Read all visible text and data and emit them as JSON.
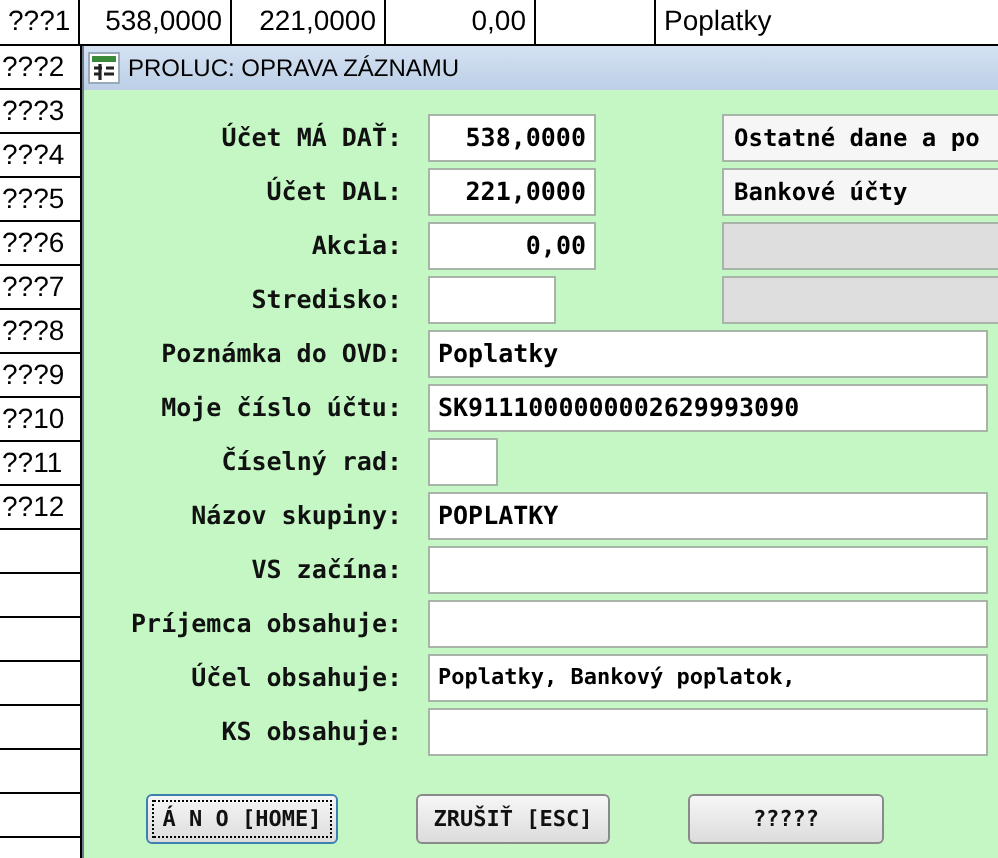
{
  "background_table": {
    "top_row": [
      "???1",
      "538,0000",
      "221,0000",
      "0,00",
      "Poplatky"
    ],
    "row_labels": [
      "???2",
      "???3",
      "???4",
      "???5",
      "???6",
      "???7",
      "???8",
      "???9",
      "??10",
      "??11",
      "??12"
    ]
  },
  "dialog": {
    "title": "PROLUC: OPRAVA ZÁZNAMU",
    "fields": [
      {
        "label": "Účet MÁ DAŤ:",
        "kind": "amount",
        "value": "538,0000",
        "lookup": {
          "disabled": false,
          "text": "Ostatné dane a po"
        }
      },
      {
        "label": "Účet DAL:",
        "kind": "amount",
        "value": "221,0000",
        "lookup": {
          "disabled": false,
          "text": "Bankové účty"
        }
      },
      {
        "label": "Akcia:",
        "kind": "amount",
        "value": "0,00",
        "lookup": {
          "disabled": true
        }
      },
      {
        "label": "Stredisko:",
        "kind": "code",
        "lookup": {
          "disabled": true
        }
      },
      {
        "label": "Poznámka do OVD:",
        "kind": "text",
        "value": "Poplatky"
      },
      {
        "label": "Moje číslo účtu:",
        "kind": "text",
        "value": "SK9111000000002629993090"
      },
      {
        "label": "Číselný rad:",
        "kind": "flag"
      },
      {
        "label": "Názov skupiny:",
        "kind": "text",
        "value": "POPLATKY"
      },
      {
        "label": "VS začína:",
        "kind": "text"
      },
      {
        "label": "Príjemca obsahuje:",
        "kind": "text"
      },
      {
        "label": "Účel obsahuje:",
        "kind": "text",
        "value": "Poplatky, Bankový poplatok,"
      },
      {
        "label": "KS obsahuje:",
        "kind": "text"
      }
    ],
    "buttons": [
      {
        "label": "Á N O [HOME]",
        "focused": true
      },
      {
        "label": "ZRUŠIŤ [ESC]",
        "focused": false
      },
      {
        "label": "?????",
        "focused": false
      }
    ]
  }
}
